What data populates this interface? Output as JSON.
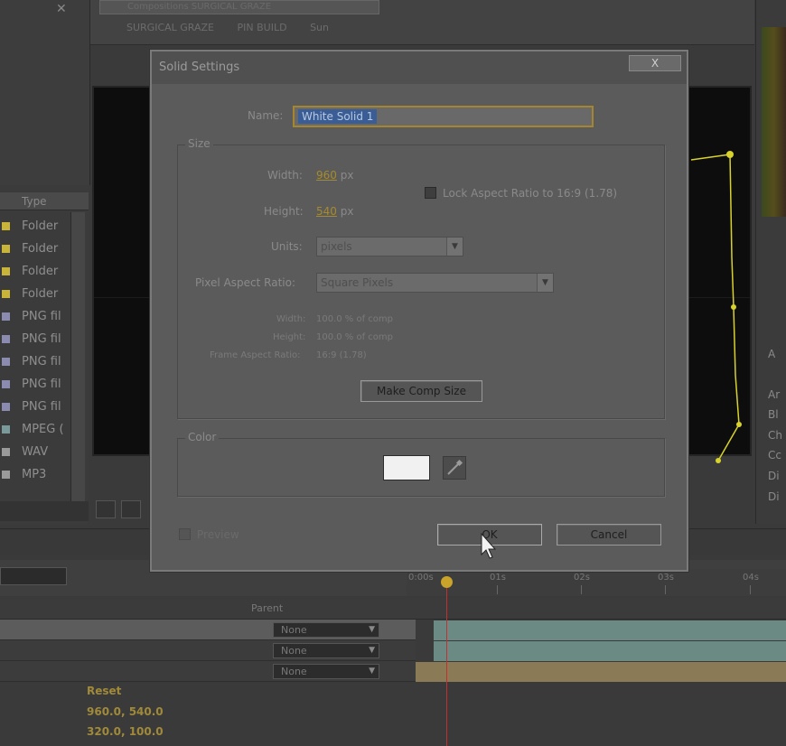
{
  "window": {
    "tab_title": "Compositions SURGICAL GRAZE",
    "breadcrumbs": [
      "SURGICAL GRAZE",
      "PIN BUILD",
      "Sun"
    ]
  },
  "project": {
    "column_type": "Type",
    "items": [
      {
        "label": "Folder",
        "color": "#c9b43a"
      },
      {
        "label": "Folder",
        "color": "#c9b43a"
      },
      {
        "label": "Folder",
        "color": "#c9b43a"
      },
      {
        "label": "Folder",
        "color": "#c9b43a"
      },
      {
        "label": "PNG fil",
        "color": "#8b8bb0"
      },
      {
        "label": "PNG fil",
        "color": "#8b8bb0"
      },
      {
        "label": "PNG fil",
        "color": "#8b8bb0"
      },
      {
        "label": "PNG fil",
        "color": "#8b8bb0"
      },
      {
        "label": "PNG fil",
        "color": "#8b8bb0"
      },
      {
        "label": "MPEG (",
        "color": "#7a9a9a"
      },
      {
        "label": "WAV",
        "color": "#9a9a9a"
      },
      {
        "label": "MP3",
        "color": "#9a9a9a"
      }
    ]
  },
  "right_panel": {
    "items": [
      "A",
      "Ar",
      "Bl",
      "Ch",
      "Cc",
      "Di",
      "Di"
    ]
  },
  "dialog": {
    "title": "Solid Settings",
    "close_label": "X",
    "name_label": "Name:",
    "name_value": "White Solid 1",
    "size_group_label": "Size",
    "width_label": "Width:",
    "width_value": "960",
    "height_label": "Height:",
    "height_value": "540",
    "px_unit": "px",
    "lock_aspect_label": "Lock Aspect Ratio to 16:9 (1.78)",
    "units_label": "Units:",
    "units_value": "pixels",
    "pixel_aspect_label": "Pixel Aspect Ratio:",
    "pixel_aspect_value": "Square Pixels",
    "info_width_label": "Width:",
    "info_width_value": "100.0 % of comp",
    "info_height_label": "Height:",
    "info_height_value": "100.0 % of comp",
    "info_frame_label": "Frame Aspect Ratio:",
    "info_frame_value": "16:9 (1.78)",
    "make_comp_size_label": "Make Comp Size",
    "color_group_label": "Color",
    "swatch_color": "#f1f1f1",
    "preview_label": "Preview",
    "ok_label": "OK",
    "cancel_label": "Cancel"
  },
  "timeline": {
    "parent_column_label": "Parent",
    "ruler_labels": [
      "0:00s",
      "01s",
      "02s",
      "03s",
      "04s"
    ],
    "layers": [
      {
        "parent": "None"
      },
      {
        "parent": "None"
      },
      {
        "parent": "None"
      }
    ],
    "properties": [
      "Reset",
      "960.0, 540.0",
      "320.0, 100.0"
    ],
    "playhead_color": "#c43030"
  }
}
